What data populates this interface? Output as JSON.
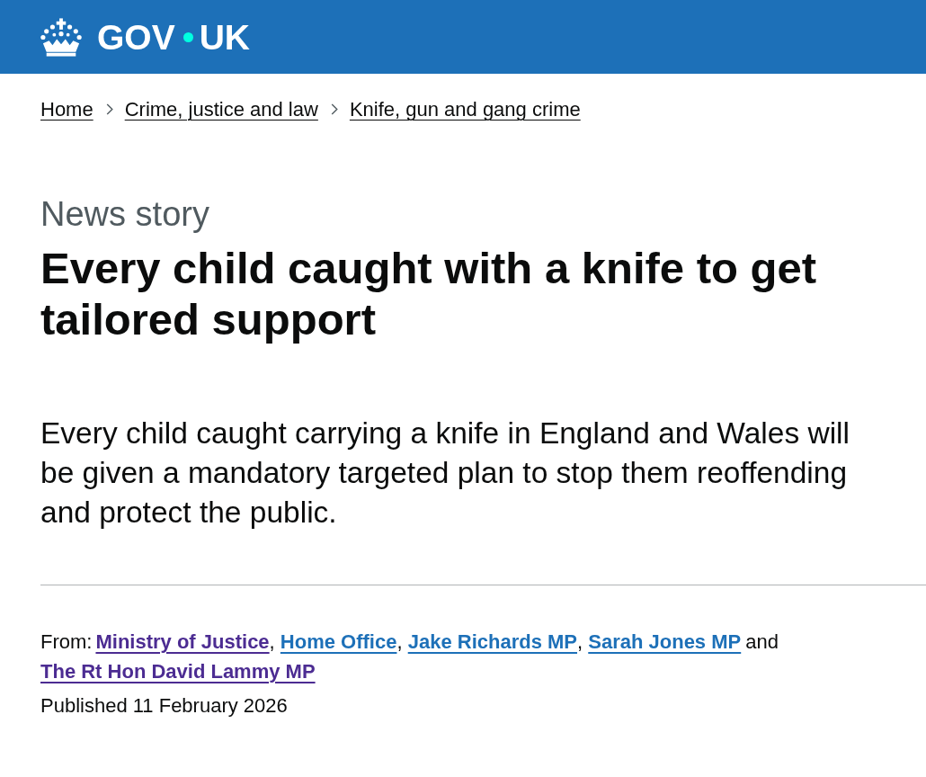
{
  "header": {
    "logo": {
      "left": "GOV",
      "right": "UK"
    }
  },
  "breadcrumbs": [
    "Home",
    "Crime, justice and law",
    "Knife, gun and gang crime"
  ],
  "article": {
    "type_label": "News story",
    "title": "Every child caught with a knife to get tailored support",
    "lead": "Every child caught carrying a knife in England and Wales will be given a mandatory targeted plan to stop them reoffending and protect the public."
  },
  "metadata": {
    "from_label": "From:",
    "from": [
      {
        "name": "Ministry of Justice",
        "visited": true,
        "separator": {
          "text": ",",
          "kind": "punctuation"
        }
      },
      {
        "name": "Home Office",
        "visited": false,
        "separator": {
          "text": ",",
          "kind": "punctuation"
        }
      },
      {
        "name": "Jake Richards MP",
        "visited": false,
        "separator": {
          "text": ",",
          "kind": "punctuation"
        }
      },
      {
        "name": "Sarah Jones MP",
        "visited": false,
        "separator": {
          "text": "and",
          "kind": "word"
        }
      },
      {
        "name": "The Rt Hon David Lammy MP",
        "visited": true
      }
    ],
    "published": "Published 11 February 2026"
  }
}
